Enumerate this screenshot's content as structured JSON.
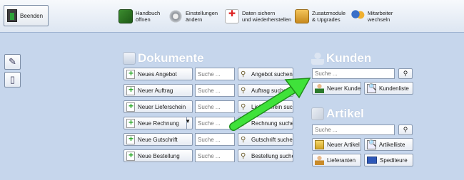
{
  "toolbar": {
    "exit_label": "Beenden",
    "items": [
      {
        "line1": "Handbuch",
        "line2": "öffnen"
      },
      {
        "line1": "Einstellungen",
        "line2": "ändern"
      },
      {
        "line1": "Daten sichern",
        "line2": "und wiederherstellen"
      },
      {
        "line1": "Zusatzmodule",
        "line2": "& Upgrades"
      },
      {
        "line1": "Mitarbeiter",
        "line2": "wechseln"
      }
    ]
  },
  "sidebar": {
    "icons": [
      "pencil-icon",
      "document-icon"
    ]
  },
  "dokumente": {
    "title": "Dokumente",
    "rows": [
      {
        "new_label": "Neues Angebot",
        "search_placeholder": "Suche ...",
        "search_label": "Angebot suchen"
      },
      {
        "new_label": "Neuer Auftrag",
        "search_placeholder": "Suche ...",
        "search_label": "Auftrag suchen"
      },
      {
        "new_label": "Neuer Lieferschein",
        "search_placeholder": "Suche ...",
        "search_label": "Lieferschein suchen"
      },
      {
        "new_label": "Neue Rechnung",
        "search_placeholder": "Suche ...",
        "search_label": "Rechnung suchen"
      },
      {
        "new_label": "Neue Gutschrift",
        "search_placeholder": "Suche ...",
        "search_label": "Gutschrift suchen"
      },
      {
        "new_label": "Neue Bestellung",
        "search_placeholder": "Suche ...",
        "search_label": "Bestellung suchen"
      }
    ]
  },
  "kunden": {
    "title": "Kunden",
    "search_placeholder": "Suche ...",
    "new_label": "Neuer Kunde",
    "list_label": "Kundenliste"
  },
  "artikel": {
    "title": "Artikel",
    "search_placeholder": "Suche ...",
    "new_label": "Neuer Artikel",
    "list_label": "Artikelliste",
    "suppliers_label": "Lieferanten",
    "carriers_label": "Spediteure"
  },
  "colors": {
    "background": "#c6d6ec",
    "arrow": "#3fe23a"
  }
}
